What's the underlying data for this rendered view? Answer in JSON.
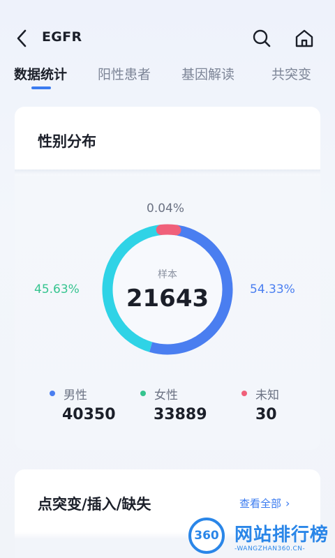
{
  "header": {
    "title": "EGFR",
    "icons": {
      "back": "back-icon",
      "search": "search-icon",
      "home": "home-icon"
    }
  },
  "tabs": [
    {
      "label": "数据统计",
      "active": true
    },
    {
      "label": "阳性患者",
      "active": false
    },
    {
      "label": "基因解读",
      "active": false
    },
    {
      "label": "共突变",
      "active": false
    }
  ],
  "gender_card": {
    "title": "性别分布",
    "center_label": "样本",
    "total": "21643",
    "unknown_pct": "0.04%",
    "female_pct": "45.63%",
    "male_pct": "54.33%",
    "legend": [
      {
        "label": "男性",
        "value": "40350",
        "color": "#4a7ef0"
      },
      {
        "label": "女性",
        "value": "33889",
        "color": "#35c48f"
      },
      {
        "label": "未知",
        "value": "30",
        "color": "#f0607a"
      }
    ]
  },
  "mutation_card": {
    "title": "点突变/插入/缺失",
    "view_all": "查看全部"
  },
  "chart_data": {
    "type": "pie",
    "donut": true,
    "categories": [
      "男性",
      "女性",
      "未知"
    ],
    "values": [
      54.33,
      45.63,
      0.04
    ],
    "colors": [
      "#4a7ef0",
      "#2fd3e6",
      "#f0607a"
    ],
    "center_text": "21643"
  },
  "watermark": {
    "logo_text": "360",
    "name": "网站排行榜",
    "domain": "-WANGZHAN360.CN-"
  },
  "colors": {
    "accent": "#3a7bf0",
    "male": "#4a7ef0",
    "female_ring": "#2fd3e6",
    "female_text": "#35c48f",
    "unknown": "#f0607a"
  }
}
